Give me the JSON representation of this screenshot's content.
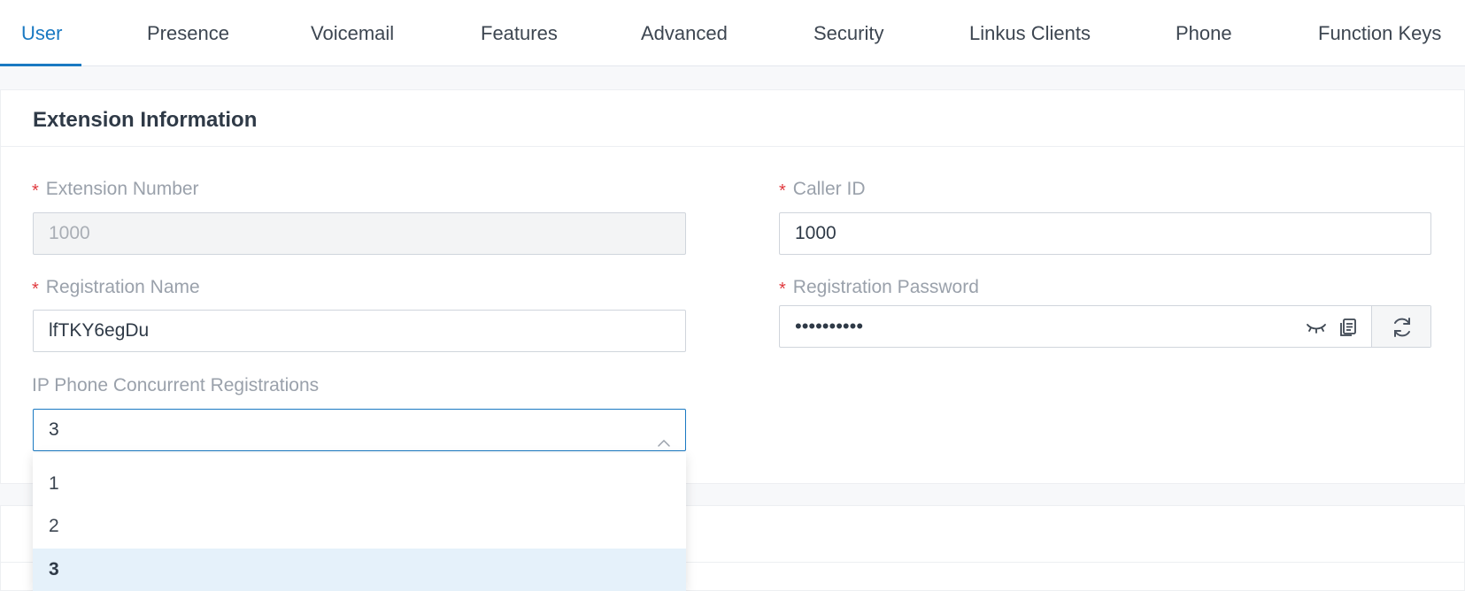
{
  "tabs": [
    {
      "label": "User",
      "active": true
    },
    {
      "label": "Presence"
    },
    {
      "label": "Voicemail"
    },
    {
      "label": "Features"
    },
    {
      "label": "Advanced"
    },
    {
      "label": "Security"
    },
    {
      "label": "Linkus Clients"
    },
    {
      "label": "Phone"
    },
    {
      "label": "Function Keys"
    }
  ],
  "section": {
    "title": "Extension Information"
  },
  "fields": {
    "extension_number": {
      "label": "Extension Number",
      "value": "1000",
      "required": "*"
    },
    "caller_id": {
      "label": "Caller ID",
      "value": "1000",
      "required": "*"
    },
    "registration_name": {
      "label": "Registration Name",
      "value": "lfTKY6egDu",
      "required": "*"
    },
    "registration_password": {
      "label": "Registration Password",
      "masked_value": "••••••••••",
      "required": "*"
    },
    "concurrent_registrations": {
      "label": "IP Phone Concurrent Registrations",
      "value": "3"
    }
  },
  "dropdown": {
    "options": [
      "1",
      "2",
      "3"
    ],
    "selected": "3"
  },
  "icons": {
    "toggle_visibility": "eye-closed-icon",
    "copy": "copy-icon",
    "refresh": "refresh-icon",
    "chevron": "chevron-up-icon"
  },
  "colors": {
    "accent": "#1a79c2",
    "required": "#e0393e",
    "selected_option_bg": "#e5f1fa"
  }
}
